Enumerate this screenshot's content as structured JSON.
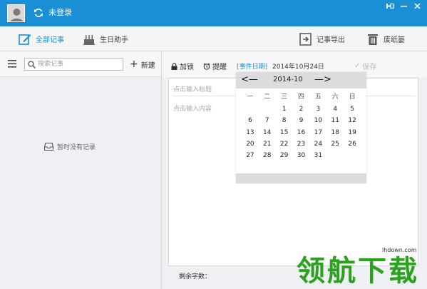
{
  "titlebar": {
    "login_status": "未登录",
    "bg_color": "#1a8fd6"
  },
  "tabs": {
    "all_notes": "全部记事",
    "birthday": "生日助手",
    "export": "记事导出",
    "trash": "废纸篓"
  },
  "left": {
    "search_placeholder": "搜索记事",
    "new_label": "新建",
    "empty_text": "暂时没有记录"
  },
  "editor": {
    "lock_label": "加锁",
    "remind_label": "提醒",
    "event_date_tag": "[事件日期]",
    "event_date_value": "2014年10月24日",
    "save_label": "保存",
    "title_placeholder": "点击输入标题",
    "content_placeholder": "点击输入内容",
    "remaining_label": "剩余字数："
  },
  "calendar": {
    "month_title": "2014-10",
    "prev": "<—",
    "next": "—>",
    "weekdays": [
      "一",
      "二",
      "三",
      "四",
      "五",
      "六",
      "日"
    ],
    "days": [
      "",
      "",
      "1",
      "2",
      "3",
      "4",
      "5",
      "6",
      "7",
      "8",
      "9",
      "10",
      "11",
      "12",
      "13",
      "14",
      "15",
      "16",
      "17",
      "18",
      "19",
      "20",
      "21",
      "22",
      "23",
      "24",
      "25",
      "26",
      "27",
      "28",
      "29",
      "30",
      "31",
      "",
      ""
    ]
  },
  "watermark": {
    "url": "lhdown.com",
    "text": "领航下载"
  }
}
